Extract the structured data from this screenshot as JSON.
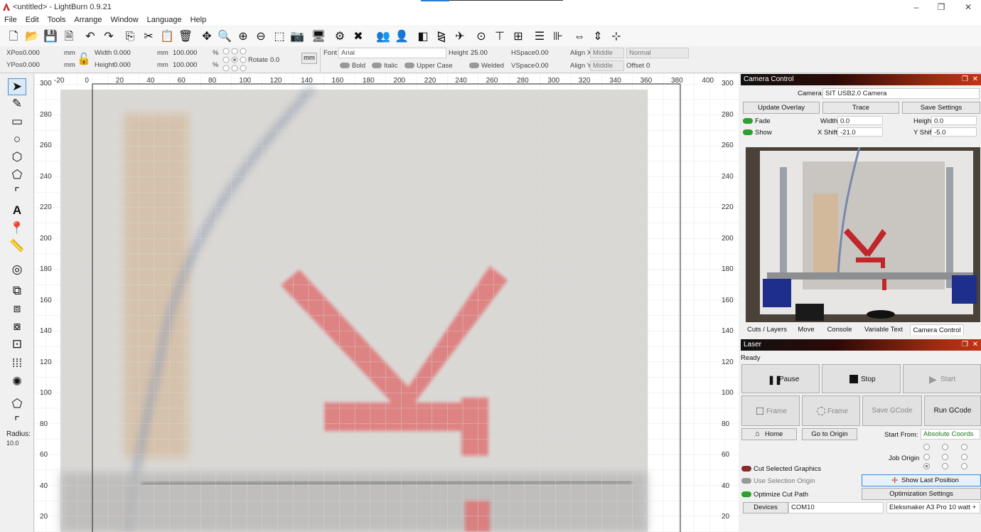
{
  "app": {
    "title": "<untitled> - LightBurn 0.9.21"
  },
  "window": {
    "min": "–",
    "max": "❐",
    "close": "✕"
  },
  "menu": [
    "File",
    "Edit",
    "Tools",
    "Arrange",
    "Window",
    "Language",
    "Help"
  ],
  "props": {
    "xpos_label": "XPos",
    "xpos": "0.000",
    "ypos_label": "YPos",
    "ypos": "0.000",
    "unit": "mm",
    "width_label": "Width",
    "width": "0.000",
    "height_label": "Height",
    "height": "0.000",
    "wpct": "100.000",
    "hpct": "100.000",
    "pct": "%",
    "rotate_label": "Rotate",
    "rotate": "0.0",
    "mm_btn": "mm",
    "font_label": "Font",
    "font": "Arial",
    "fheight_label": "Height",
    "fheight": "25.00",
    "hspace_label": "HSpace",
    "hspace": "0.00",
    "vspace_label": "VSpace",
    "vspace": "0.00",
    "alignx_label": "Align X",
    "alignx": "Middle",
    "aligny_label": "Align Y",
    "aligny": "Middle",
    "normal": "Normal",
    "offset_label": "Offset",
    "offset": "0",
    "bold": "Bold",
    "italic": "Italic",
    "upper": "Upper Case",
    "welded": "Welded"
  },
  "tools": {
    "radius_label": "Radius:",
    "radius": "10.0"
  },
  "ruler": {
    "x": [
      "-20",
      "0",
      "20",
      "40",
      "60",
      "80",
      "100",
      "120",
      "140",
      "160",
      "180",
      "200",
      "220",
      "240",
      "260",
      "280",
      "300",
      "320",
      "340",
      "360",
      "380",
      "400"
    ],
    "y": [
      "300",
      "280",
      "260",
      "240",
      "220",
      "200",
      "180",
      "160",
      "140",
      "120",
      "100",
      "80",
      "60",
      "40",
      "20"
    ]
  },
  "camera": {
    "title": "Camera Control",
    "camera_label": "Camera:",
    "camera": "SIT USB2.0 Camera",
    "update_overlay": "Update Overlay",
    "trace": "Trace",
    "save_settings": "Save Settings",
    "fade": "Fade",
    "show": "Show",
    "width_label": "Width",
    "width": "0.0",
    "height_label": "Height",
    "height": "0.0",
    "xshift_label": "X Shift",
    "xshift": "-21.0",
    "yshift_label": "Y Shift",
    "yshift": "-5.0"
  },
  "tabs": [
    "Cuts / Layers",
    "Move",
    "Console",
    "Variable Text",
    "Camera Control"
  ],
  "laser": {
    "title": "Laser",
    "status": "Ready",
    "pause": "Pause",
    "stop": "Stop",
    "start": "Start",
    "frame1": "Frame",
    "frame2": "Frame",
    "save_gcode": "Save GCode",
    "run_gcode": "Run GCode",
    "home": "Home",
    "go_origin": "Go to Origin",
    "start_from_label": "Start From:",
    "start_from": "Absolute Coords",
    "job_origin": "Job Origin",
    "cut_selected": "Cut Selected Graphics",
    "use_sel_origin": "Use Selection Origin",
    "show_last": "Show Last Position",
    "optimize": "Optimize Cut Path",
    "opt_settings": "Optimization Settings",
    "devices": "Devices",
    "port": "COM10",
    "device": "Eleksmaker A3 Pro 10 watt +"
  },
  "colors": {
    "accent_on": "#2ea02e",
    "accent_red": "#c23417",
    "toggle_off": "#8b2a2a"
  }
}
